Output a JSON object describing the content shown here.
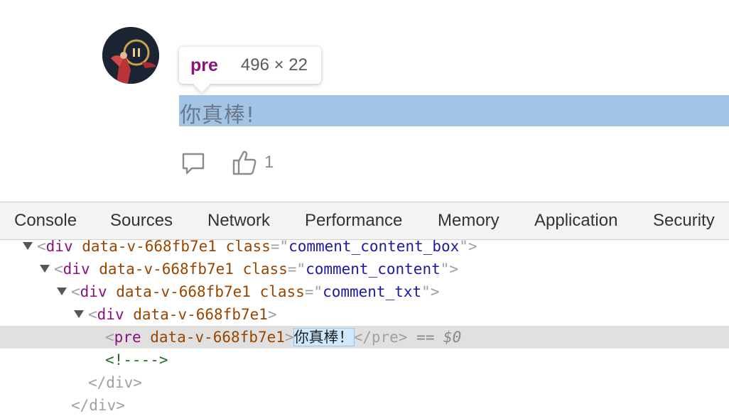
{
  "tooltip": {
    "tag": "pre",
    "size": "496 × 22"
  },
  "comment": {
    "text": "你真棒!",
    "like_count": "1"
  },
  "icons": {
    "comment": "comment-icon",
    "like": "thumbs-up-icon",
    "avatar": "user-avatar"
  },
  "colors": {
    "highlight": "#a2c5e6",
    "tag": "#881280",
    "attr_name": "#994500",
    "attr_value": "#1a1aa6"
  },
  "devtools": {
    "tabs": [
      "Console",
      "Sources",
      "Network",
      "Performance",
      "Memory",
      "Application",
      "Security"
    ],
    "dom": [
      {
        "open": "<",
        "tag": "div",
        "attr": "data-v-668fb7e1",
        "class_label": "class",
        "eq": "=\"",
        "class_value": "comment_content_box",
        "close": "\">"
      },
      {
        "open": "<",
        "tag": "div",
        "attr": "data-v-668fb7e1",
        "class_label": "class",
        "eq": "=\"",
        "class_value": "comment_content",
        "close": "\">"
      },
      {
        "open": "<",
        "tag": "div",
        "attr": "data-v-668fb7e1",
        "class_label": "class",
        "eq": "=\"",
        "class_value": "comment_txt",
        "close": "\">"
      },
      {
        "open": "<",
        "tag": "div",
        "attr": "data-v-668fb7e1",
        "close": ">"
      },
      {
        "open": "<",
        "tag": "pre",
        "attr": "data-v-668fb7e1",
        "close": ">",
        "text": "你真棒！",
        "end": "</pre>",
        "eq_marker": " == ",
        "ref": "$0"
      },
      {
        "comment": "<!---->"
      },
      {
        "end": "</div>"
      },
      {
        "end": "</div>"
      }
    ]
  }
}
